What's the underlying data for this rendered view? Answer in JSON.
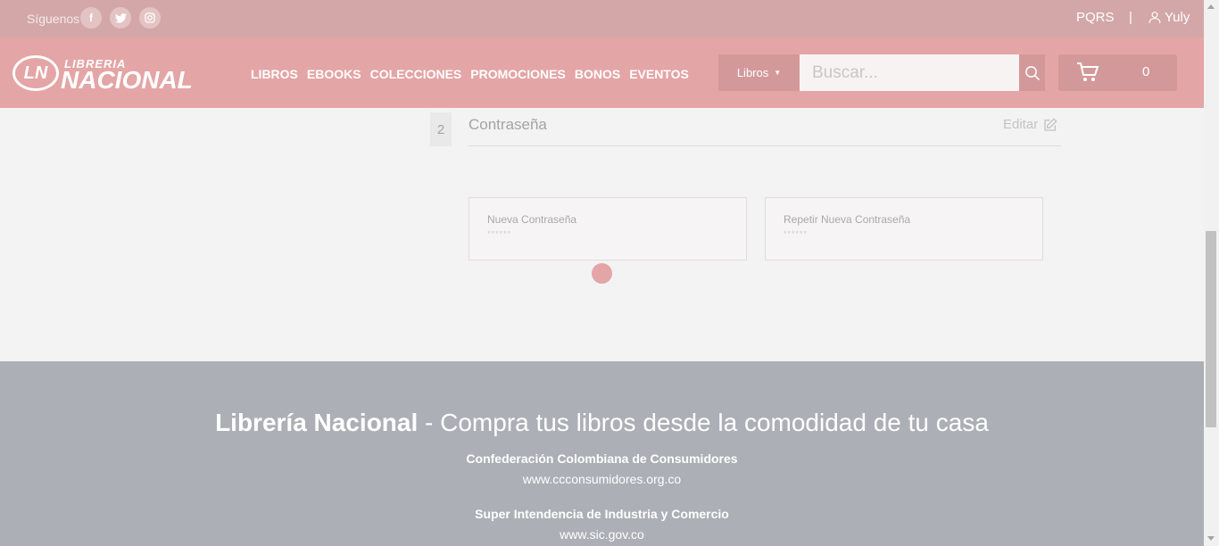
{
  "topbar": {
    "follow_label": "Síguenos",
    "social": [
      {
        "name": "facebook-icon",
        "glyph": "f"
      },
      {
        "name": "twitter-icon",
        "glyph": "t"
      },
      {
        "name": "instagram-icon",
        "glyph": "◎"
      }
    ],
    "pqrs": "PQRS",
    "separator": "|",
    "user_name": "Yuly"
  },
  "logo": {
    "top": "LIBRERIA",
    "bottom": "NACIONAL"
  },
  "menu": [
    "LIBROS",
    "EBOOKS",
    "COLECCIONES",
    "PROMOCIONES",
    "BONOS",
    "EVENTOS"
  ],
  "search": {
    "category": "Libros",
    "placeholder": "Buscar..."
  },
  "cart": {
    "count": "0"
  },
  "password_section": {
    "step": "2",
    "title": "Contraseña",
    "edit_label": "Editar",
    "new_password_label": "Nueva Contraseña",
    "new_password_value": "******",
    "repeat_password_label": "Repetir Nueva Contraseña",
    "repeat_password_value": "******"
  },
  "footer": {
    "brand": "Librería Nacional",
    "tagline": " - Compra tus libros desde la comodidad de tu casa",
    "orgs": [
      {
        "name": "Confederación Colombiana de Consumidores",
        "url": "www.ccconsumidores.org.co"
      },
      {
        "name": "Super Intendencia de Industria y Comercio",
        "url": "www.sic.gov.co"
      }
    ]
  },
  "colors": {
    "brand_pink": "#e4a5a6",
    "topbar": "#d3a7a8",
    "footer": "#acafb6"
  }
}
